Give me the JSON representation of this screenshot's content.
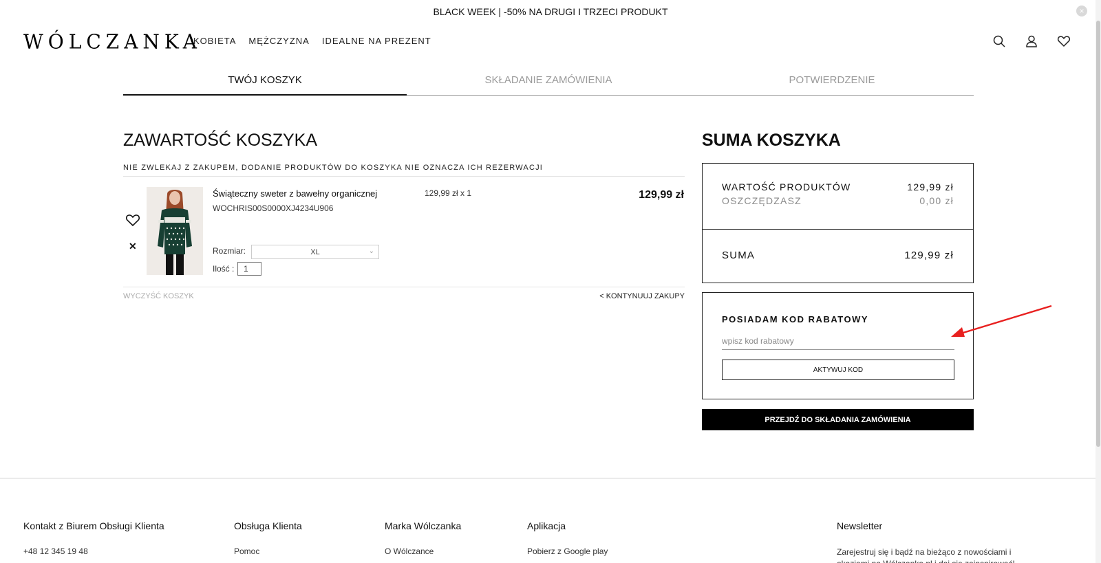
{
  "promo": {
    "text": "BLACK WEEK | -50% NA DRUGI I TRZECI PRODUKT",
    "close_icon": "close-icon"
  },
  "header": {
    "logo": "WÓLCZANKA",
    "nav": [
      {
        "label": "KOBIETA"
      },
      {
        "label": "MĘŻCZYZNA"
      },
      {
        "label": "IDEALNE NA PREZENT"
      }
    ],
    "icons": [
      "search-icon",
      "user-icon",
      "heart-icon"
    ]
  },
  "steps": [
    {
      "label": "TWÓJ KOSZYK",
      "active": true
    },
    {
      "label": "SKŁADANIE ZAMÓWIENIA",
      "active": false
    },
    {
      "label": "POTWIERDZENIE",
      "active": false
    }
  ],
  "cart": {
    "title": "ZAWARTOŚĆ KOSZYKA",
    "notice": "NIE ZWLEKAJ Z ZAKUPEM, DODANIE PRODUKTÓW DO KOSZYKA NIE OZNACZA ICH REZERWACJI",
    "item": {
      "name": "Świąteczny sweter z bawełny organicznej",
      "sku": "WOCHRIS00S0000XJ4234U906",
      "unit_price_qty": "129,99 zł x 1",
      "total": "129,99 zł",
      "size_label": "Rozmiar:",
      "size_value": "XL",
      "qty_label": "Ilość :",
      "qty_value": "1"
    },
    "clear_label": "WYCZYŚĆ KOSZYK",
    "continue_label": "< KONTYNUUJ ZAKUPY"
  },
  "summary": {
    "title": "SUMA KOSZYKA",
    "products_label": "WARTOŚĆ PRODUKTÓW",
    "products_value": "129,99 zł",
    "savings_label": "OSZCZĘDZASZ",
    "savings_value": "0,00 zł",
    "total_label": "SUMA",
    "total_value": "129,99 zł"
  },
  "coupon": {
    "title": "POSIADAM KOD RABATOWY",
    "placeholder": "wpisz kod rabatowy",
    "button": "AKTYWUJ KOD"
  },
  "checkout_button": "PRZEJDŹ DO SKŁADANIA ZAMÓWIENIA",
  "footer": {
    "columns": [
      {
        "heading": "Kontakt z Biurem Obsługi Klienta",
        "link": "+48 12 345 19 48"
      },
      {
        "heading": "Obsługa Klienta",
        "link": "Pomoc"
      },
      {
        "heading": "Marka Wólczanka",
        "link": "O Wólczance"
      },
      {
        "heading": "Aplikacja",
        "link": "Pobierz z Google play"
      },
      {
        "heading": "Newsletter",
        "link": "Zarejestruj się i bądź na bieżąco z nowościami i okazjami na Wólczanka.pl i daj się zainspirować!"
      }
    ]
  },
  "colors": {
    "accent": "#000000",
    "annotation_arrow": "#e8201f",
    "muted_text": "#9a9a9a"
  }
}
